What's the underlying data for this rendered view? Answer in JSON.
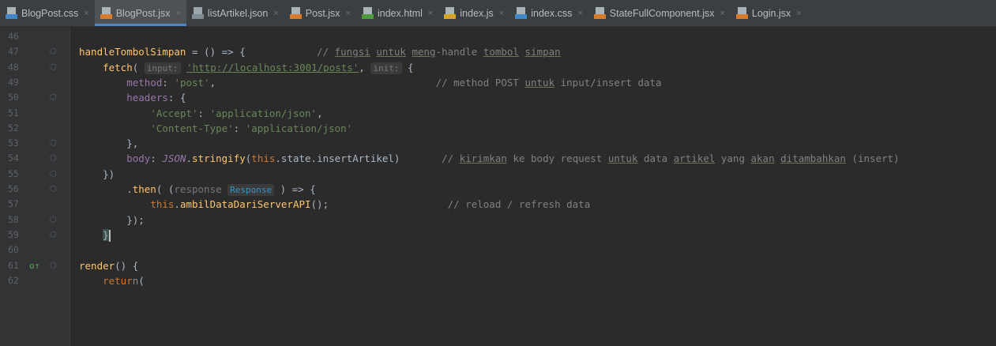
{
  "tabs": [
    {
      "name": "BlogPost.css",
      "type": "css",
      "active": false
    },
    {
      "name": "BlogPost.jsx",
      "type": "jsx",
      "active": true
    },
    {
      "name": "listArtikel.json",
      "type": "json",
      "active": false
    },
    {
      "name": "Post.jsx",
      "type": "jsx",
      "active": false
    },
    {
      "name": "index.html",
      "type": "html",
      "active": false
    },
    {
      "name": "index.js",
      "type": "js",
      "active": false
    },
    {
      "name": "index.css",
      "type": "css",
      "active": false
    },
    {
      "name": "StateFullComponent.jsx",
      "type": "jsx",
      "active": false
    },
    {
      "name": "Login.jsx",
      "type": "jsx",
      "active": false
    }
  ],
  "close_glyph": "×",
  "colors": {
    "keyword": "#cc7832",
    "function": "#ffc66d",
    "string": "#6a8759",
    "comment": "#808080",
    "property": "#9876aa",
    "text": "#a9b7c6",
    "type": "#3592c4"
  },
  "lines": [
    {
      "n": "46"
    },
    {
      "n": "47",
      "segs": [
        [
          "fn",
          "handleTombolSimpan"
        ],
        [
          "",
          " = () => {            "
        ],
        [
          "cm",
          "// "
        ],
        [
          "cm u",
          "fungsi"
        ],
        [
          "cm",
          " "
        ],
        [
          "cm u",
          "untuk"
        ],
        [
          "cm",
          " "
        ],
        [
          "cm u",
          "meng"
        ],
        [
          "cm",
          "-handle "
        ],
        [
          "cm u",
          "tombol"
        ],
        [
          "cm",
          " "
        ],
        [
          "cm u",
          "simpan"
        ]
      ]
    },
    {
      "n": "48",
      "segs": [
        [
          "",
          "    "
        ],
        [
          "fn",
          "fetch"
        ],
        [
          "",
          "( "
        ],
        [
          "hint",
          "input:"
        ],
        [
          "",
          " "
        ],
        [
          "url",
          "'http://localhost:3001/posts'"
        ],
        [
          "",
          ", "
        ],
        [
          "hint",
          "init:"
        ],
        [
          "",
          " {"
        ]
      ]
    },
    {
      "n": "49",
      "segs": [
        [
          "",
          "        "
        ],
        [
          "prop",
          "method"
        ],
        [
          "",
          ": "
        ],
        [
          "str",
          "'post'"
        ],
        [
          "",
          ",                                     "
        ],
        [
          "cm",
          "// method POST "
        ],
        [
          "cm u",
          "untuk"
        ],
        [
          "cm",
          " input/insert data"
        ]
      ]
    },
    {
      "n": "50",
      "segs": [
        [
          "",
          "        "
        ],
        [
          "prop",
          "headers"
        ],
        [
          "",
          ": {"
        ]
      ]
    },
    {
      "n": "51",
      "segs": [
        [
          "",
          "            "
        ],
        [
          "str",
          "'Accept'"
        ],
        [
          "",
          ": "
        ],
        [
          "str",
          "'application/json'"
        ],
        [
          "",
          ","
        ]
      ]
    },
    {
      "n": "52",
      "segs": [
        [
          "",
          "            "
        ],
        [
          "str",
          "'Content-Type'"
        ],
        [
          "",
          ": "
        ],
        [
          "str",
          "'application/json'"
        ]
      ]
    },
    {
      "n": "53",
      "segs": [
        [
          "",
          "        },"
        ]
      ]
    },
    {
      "n": "54",
      "segs": [
        [
          "",
          "        "
        ],
        [
          "prop",
          "body"
        ],
        [
          "",
          ": "
        ],
        [
          "prop it",
          "JSON"
        ],
        [
          "",
          "."
        ],
        [
          "fn",
          "stringify"
        ],
        [
          "",
          "("
        ],
        [
          "kw",
          "this"
        ],
        [
          "",
          ".state.insertArtikel)       "
        ],
        [
          "cm",
          "// "
        ],
        [
          "cm u",
          "kirimkan"
        ],
        [
          "cm",
          " ke body request "
        ],
        [
          "cm u",
          "untuk"
        ],
        [
          "cm",
          " data "
        ],
        [
          "cm u",
          "artikel"
        ],
        [
          "cm",
          " yang "
        ],
        [
          "cm u",
          "akan"
        ],
        [
          "cm",
          " "
        ],
        [
          "cm u",
          "ditambahkan"
        ],
        [
          "cm",
          " (insert)"
        ]
      ]
    },
    {
      "n": "55",
      "segs": [
        [
          "",
          "    })"
        ]
      ]
    },
    {
      "n": "56",
      "segs": [
        [
          "",
          "        ."
        ],
        [
          "fn",
          "then"
        ],
        [
          "",
          "( ("
        ],
        [
          "param",
          "response"
        ],
        [
          "",
          " "
        ],
        [
          "hint type",
          "Response"
        ],
        [
          "",
          " ) => {"
        ]
      ]
    },
    {
      "n": "57",
      "segs": [
        [
          "",
          "            "
        ],
        [
          "kw",
          "this"
        ],
        [
          "",
          "."
        ],
        [
          "fn",
          "ambilDataDariServerAPI"
        ],
        [
          "",
          "();                    "
        ],
        [
          "cm",
          "// reload / refresh data"
        ]
      ]
    },
    {
      "n": "58",
      "segs": [
        [
          "",
          "        });"
        ]
      ]
    },
    {
      "n": "59",
      "segs": [
        [
          "",
          "    "
        ],
        [
          "brace",
          "}"
        ]
      ]
    },
    {
      "n": "60"
    },
    {
      "n": "61",
      "segs": [
        [
          "fn",
          "render"
        ],
        [
          "",
          "() {"
        ]
      ]
    },
    {
      "n": "62",
      "segs": [
        [
          "",
          "    "
        ],
        [
          "kw",
          "return"
        ],
        [
          "",
          "("
        ]
      ]
    }
  ],
  "folds": [
    "47",
    "48",
    "50",
    "53",
    "54",
    "55",
    "56",
    "58",
    "59",
    "61"
  ],
  "override_line": "61",
  "override_icon": "o↑"
}
